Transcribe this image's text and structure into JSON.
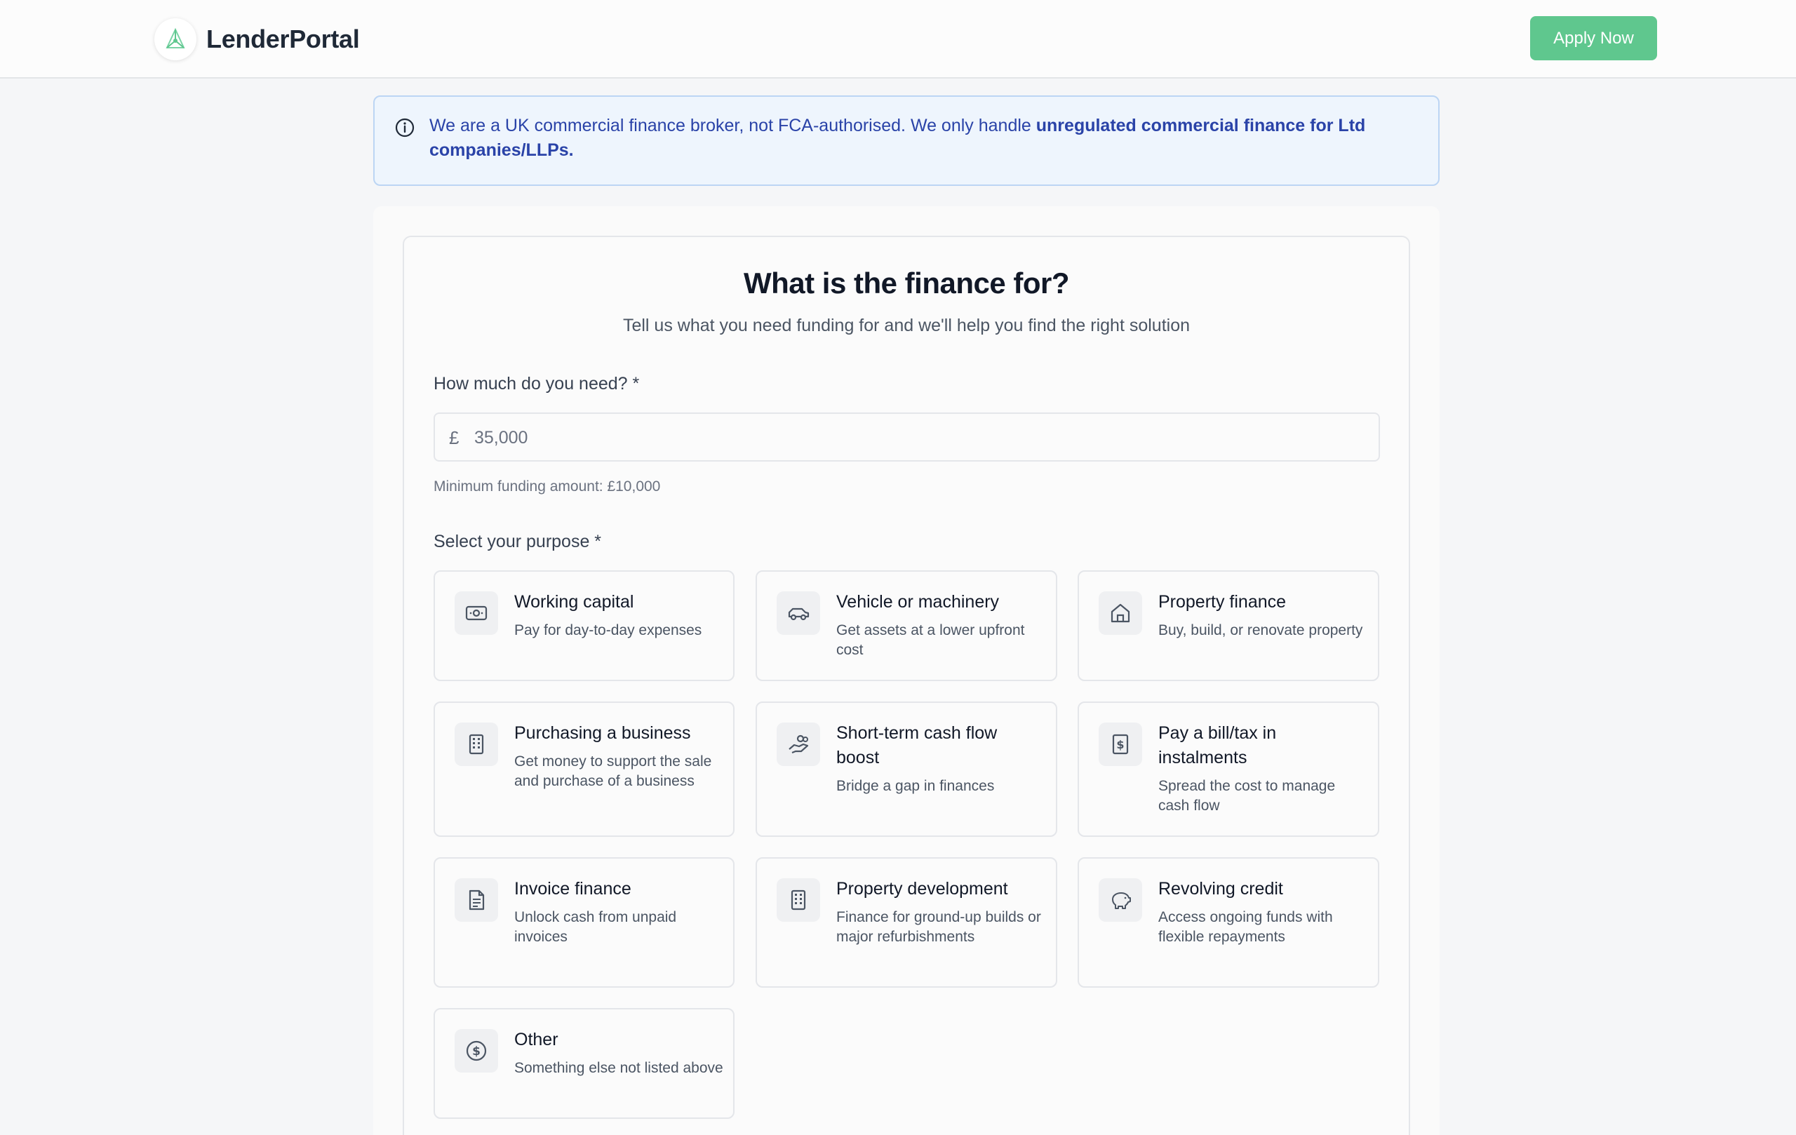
{
  "header": {
    "brand_name": "LenderPortal",
    "apply_label": "Apply Now"
  },
  "notice": {
    "text_plain": "We are a UK commercial finance broker, not FCA-authorised. We only handle ",
    "text_bold": "unregulated commercial finance for Ltd companies/LLPs."
  },
  "form": {
    "title": "What is the finance for?",
    "subtitle": "Tell us what you need funding for and we'll help you find the right solution",
    "amount_label": "How much do you need? *",
    "currency_symbol": "£",
    "amount_placeholder": "35,000",
    "amount_hint": "Minimum funding amount: £10,000",
    "purpose_label": "Select your purpose *",
    "purposes": [
      {
        "title": "Working capital",
        "description": "Pay for day-to-day expenses",
        "icon": "banknote-icon"
      },
      {
        "title": "Vehicle or machinery",
        "description": "Get assets at a lower upfront cost",
        "icon": "car-icon"
      },
      {
        "title": "Property finance",
        "description": "Buy, build, or renovate property",
        "icon": "house-icon"
      },
      {
        "title": "Purchasing a business",
        "description": "Get money to support the sale and purchase of a business",
        "icon": "building-icon"
      },
      {
        "title": "Short-term cash flow boost",
        "description": "Bridge a gap in finances",
        "icon": "hand-coins-icon"
      },
      {
        "title": "Pay a bill/tax in instalments",
        "description": "Spread the cost to manage cash flow",
        "icon": "receipt-icon"
      },
      {
        "title": "Invoice finance",
        "description": "Unlock cash from unpaid invoices",
        "icon": "document-icon"
      },
      {
        "title": "Property development",
        "description": "Finance for ground-up builds or major refurbishments",
        "icon": "building-icon"
      },
      {
        "title": "Revolving credit",
        "description": "Access ongoing funds with flexible repayments",
        "icon": "piggy-bank-icon"
      },
      {
        "title": "Other",
        "description": "Something else not listed above",
        "icon": "dollar-circle-icon"
      }
    ]
  },
  "colors": {
    "accent_green": "#5fc78e",
    "notice_bg": "#eef5fd",
    "notice_text": "#2a43a8"
  }
}
